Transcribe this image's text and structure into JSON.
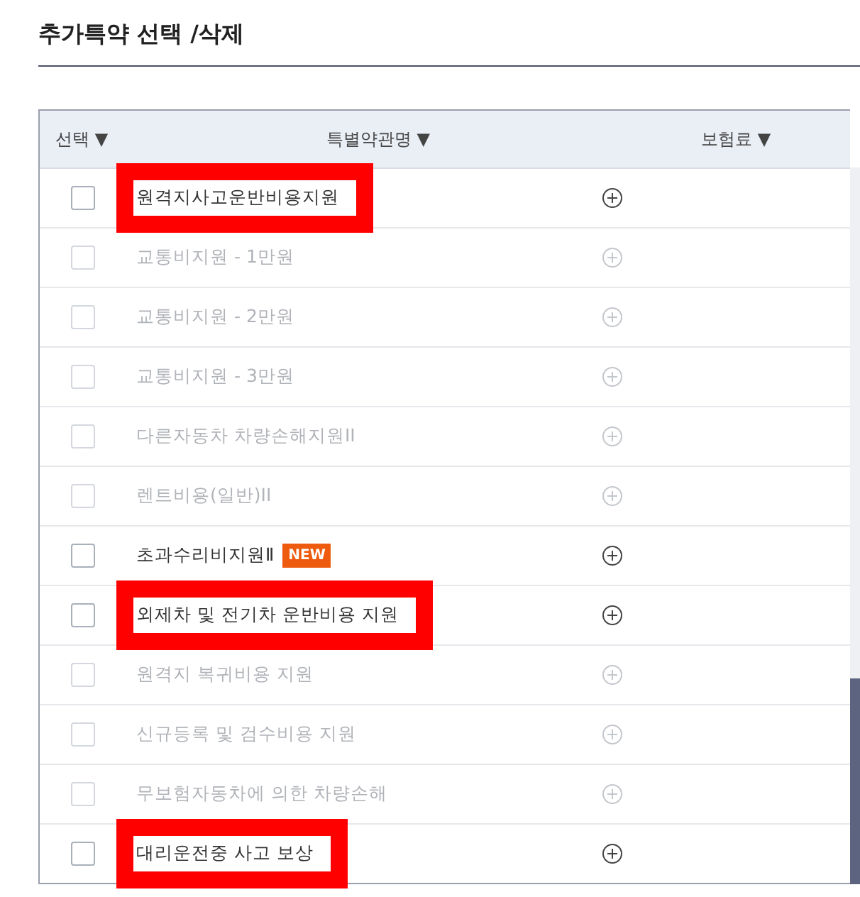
{
  "title": "추가특약 선택 /삭제",
  "columns": [
    {
      "label": "선택",
      "sort": "▼"
    },
    {
      "label": "특별약관명",
      "sort": "▼"
    },
    {
      "label": "보험료",
      "sort": "▼"
    }
  ],
  "rows": [
    {
      "name": "원격지사고운반비용지원",
      "checked": false,
      "disabled": false,
      "highlighted": true
    },
    {
      "name": "교통비지원 - 1만원",
      "checked": false,
      "disabled": true,
      "highlighted": false
    },
    {
      "name": "교통비지원 - 2만원",
      "checked": false,
      "disabled": true,
      "highlighted": false
    },
    {
      "name": "교통비지원 - 3만원",
      "checked": false,
      "disabled": true,
      "highlighted": false
    },
    {
      "name": "다른자동차 차량손해지원II",
      "checked": false,
      "disabled": true,
      "highlighted": false
    },
    {
      "name": "렌트비용(일반)II",
      "checked": false,
      "disabled": true,
      "highlighted": false
    },
    {
      "name": "초과수리비지원Ⅱ",
      "badge": "NEW",
      "checked": false,
      "disabled": false,
      "highlighted": false
    },
    {
      "name": "외제차 및 전기차 운반비용 지원",
      "checked": false,
      "disabled": false,
      "highlighted": true
    },
    {
      "name": "원격지 복귀비용 지원",
      "checked": false,
      "disabled": true,
      "highlighted": false
    },
    {
      "name": "신규등록 및 검수비용 지원",
      "checked": false,
      "disabled": true,
      "highlighted": false
    },
    {
      "name": "무보험자동차에 의한 차량손해",
      "checked": false,
      "disabled": true,
      "highlighted": false
    },
    {
      "name": "대리운전중 사고 보상",
      "checked": false,
      "disabled": false,
      "highlighted": true
    }
  ]
}
